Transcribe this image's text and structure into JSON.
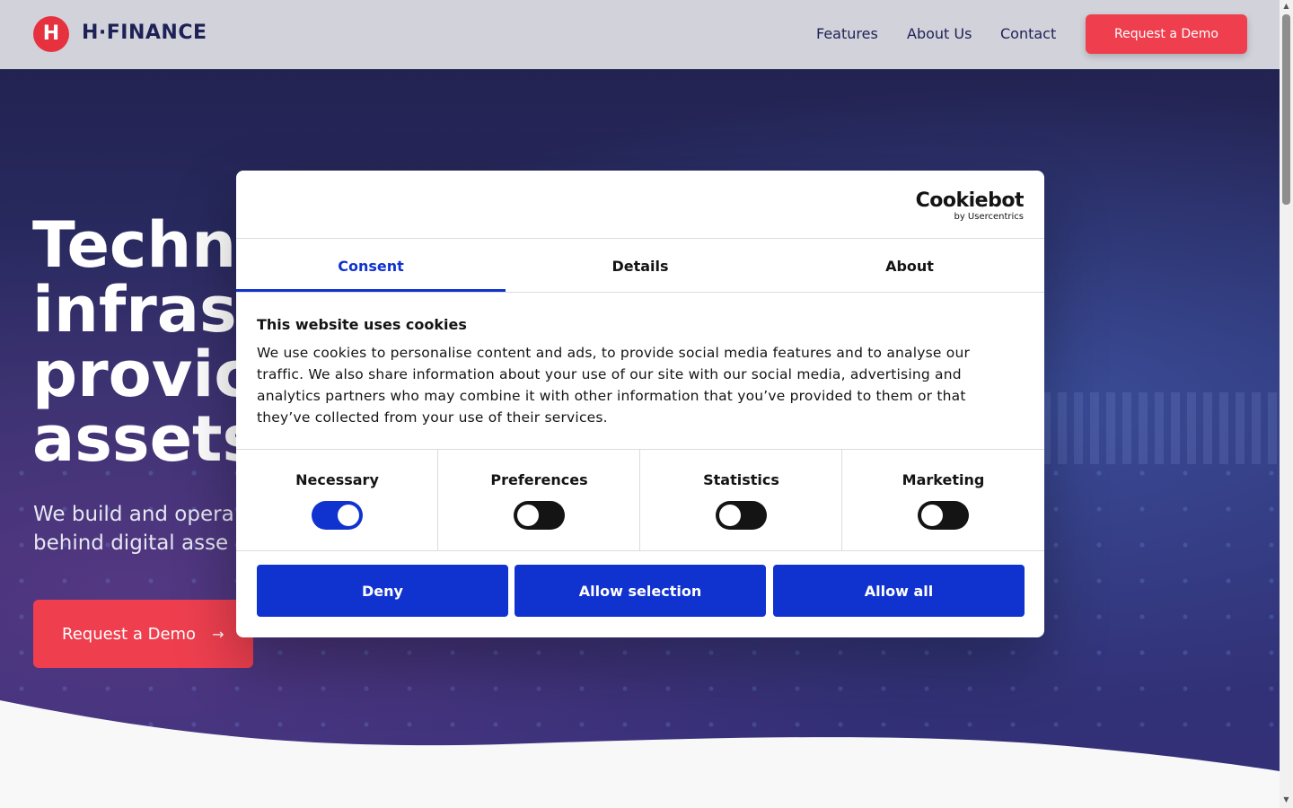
{
  "header": {
    "logo_letter": "H",
    "logo_text": "H·FINANCE",
    "nav": [
      "Features",
      "About Us",
      "Contact"
    ],
    "cta_label": "Request a Demo"
  },
  "hero": {
    "title_lines": [
      "Techn",
      "infras",
      "provic",
      "assets"
    ],
    "subtitle_lines": [
      "We build and opera",
      "behind digital asse"
    ],
    "cta_label": "Request a Demo",
    "cta_arrow": "→"
  },
  "cookie_dialog": {
    "brand_name": "Cookiebot",
    "brand_sub": "by Usercentrics",
    "tabs": [
      "Consent",
      "Details",
      "About"
    ],
    "active_tab": "Consent",
    "title": "This website uses cookies",
    "body": "We use cookies to personalise content and ads, to provide social media features and to analyse our traffic. We also share information about your use of our site with our social media, advertising and analytics partners who may combine it with other information that you’ve provided to them or that they’ve collected from your use of their services.",
    "categories": [
      {
        "label": "Necessary",
        "enabled": true
      },
      {
        "label": "Preferences",
        "enabled": false
      },
      {
        "label": "Statistics",
        "enabled": false
      },
      {
        "label": "Marketing",
        "enabled": false
      }
    ],
    "buttons": {
      "deny": "Deny",
      "allow_selection": "Allow selection",
      "allow_all": "Allow all"
    }
  },
  "scrollbar": {
    "up": "▲",
    "down": "▼"
  },
  "colors": {
    "accent_red": "#ef3f4f",
    "navy": "#1e2156",
    "cookie_blue": "#1032cf",
    "header_bg": "#d2d2db"
  }
}
